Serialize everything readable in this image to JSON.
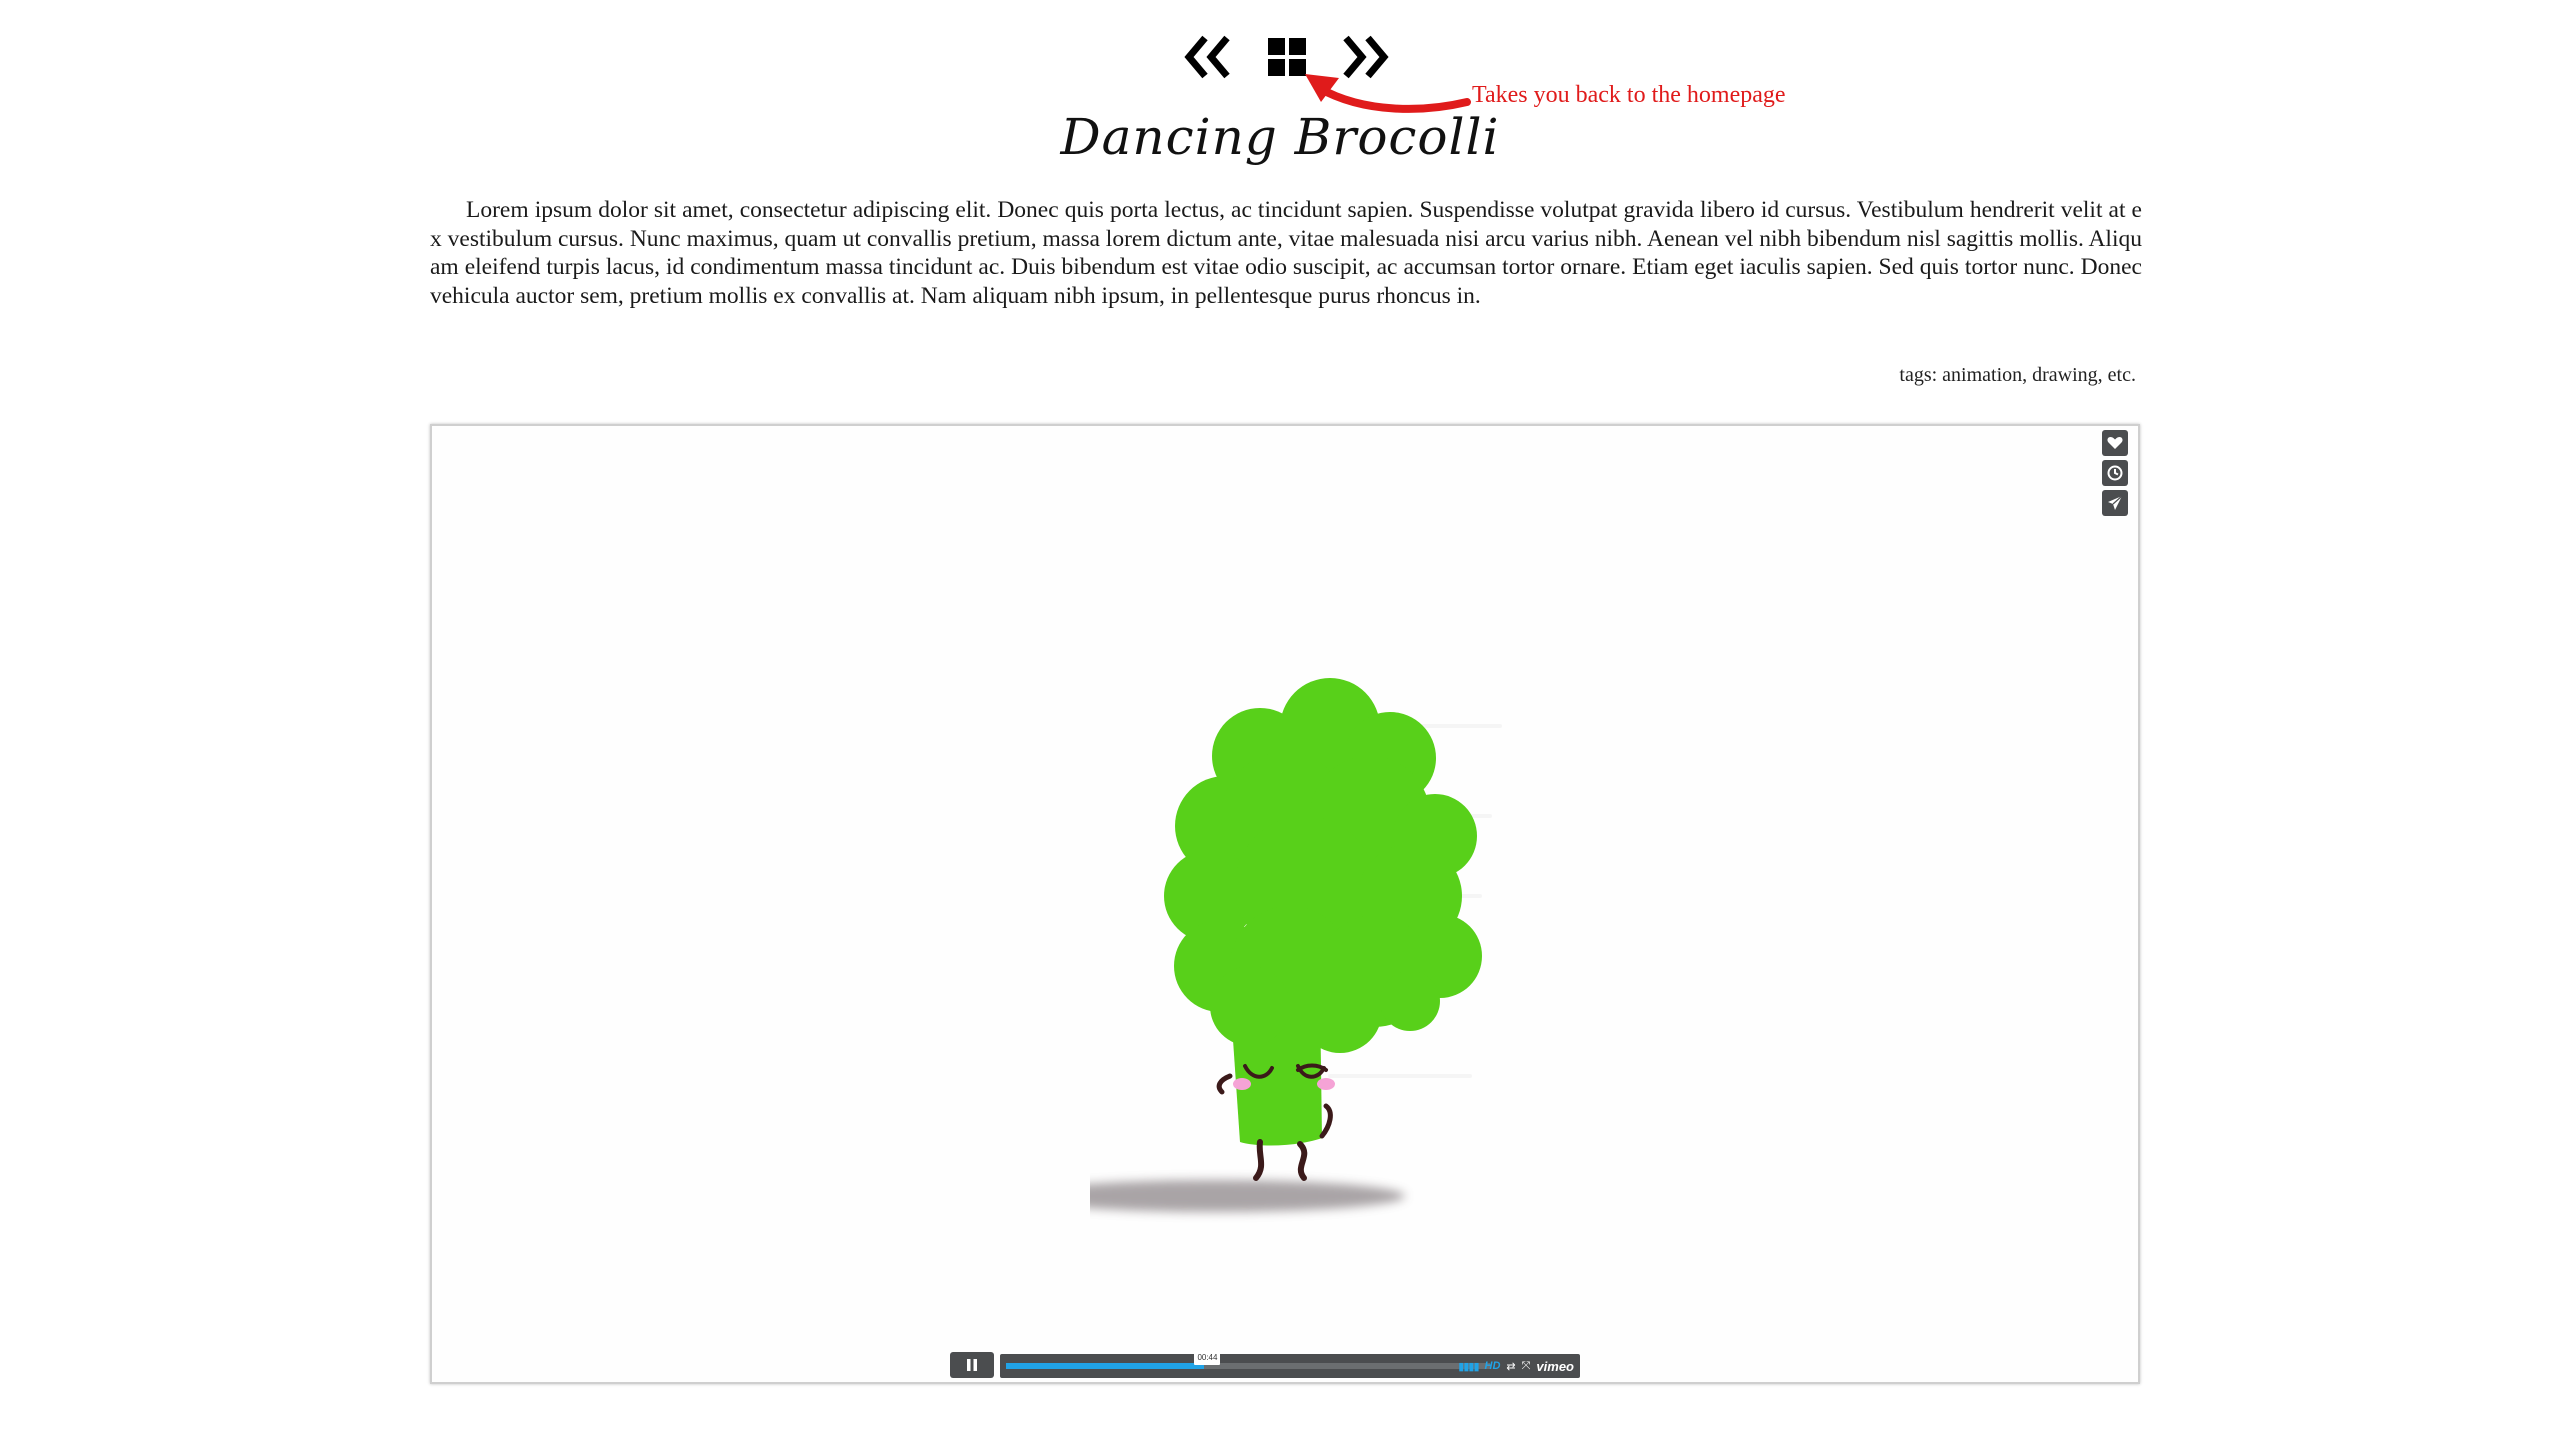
{
  "nav": {
    "prev_icon": "double-chevron-left-icon",
    "home_icon": "grid-icon",
    "next_icon": "double-chevron-right-icon"
  },
  "annotation": {
    "text": "Takes you back to the homepage",
    "color": "#e01b1b"
  },
  "page": {
    "title": "Dancing Brocolli",
    "body": "Lorem ipsum dolor sit amet, consectetur adipiscing elit. Donec quis porta lectus, ac tincidunt sapien. Suspendisse volutpat gravida libero id cursus. Vestibulum hendrerit velit at ex vestibulum cursus. Nunc maximus, quam ut convallis pretium, massa lorem dictum ante, vitae malesuada nisi arcu varius nibh. Aenean vel nibh bibendum nisl sagittis mollis. Aliquam eleifend turpis lacus, id condimentum massa tincidunt ac. Duis bibendum est vitae odio suscipit, ac accumsan tortor ornare. Etiam eget iaculis sapien. Sed quis tortor nunc. Donec vehicula auctor sem, pretium mollis ex convallis at. Nam aliquam nibh ipsum, in pellentesque purus rhoncus in.",
    "tags": "tags: animation, drawing, etc."
  },
  "video": {
    "side_tools": [
      "heart-icon",
      "clock-icon",
      "send-icon"
    ],
    "progress_fraction": 0.41,
    "time_label": "00:44",
    "hd_label": "HD",
    "brand": "vimeo",
    "accent_color": "#21a3e6",
    "broccoli_color": "#58d01a"
  }
}
